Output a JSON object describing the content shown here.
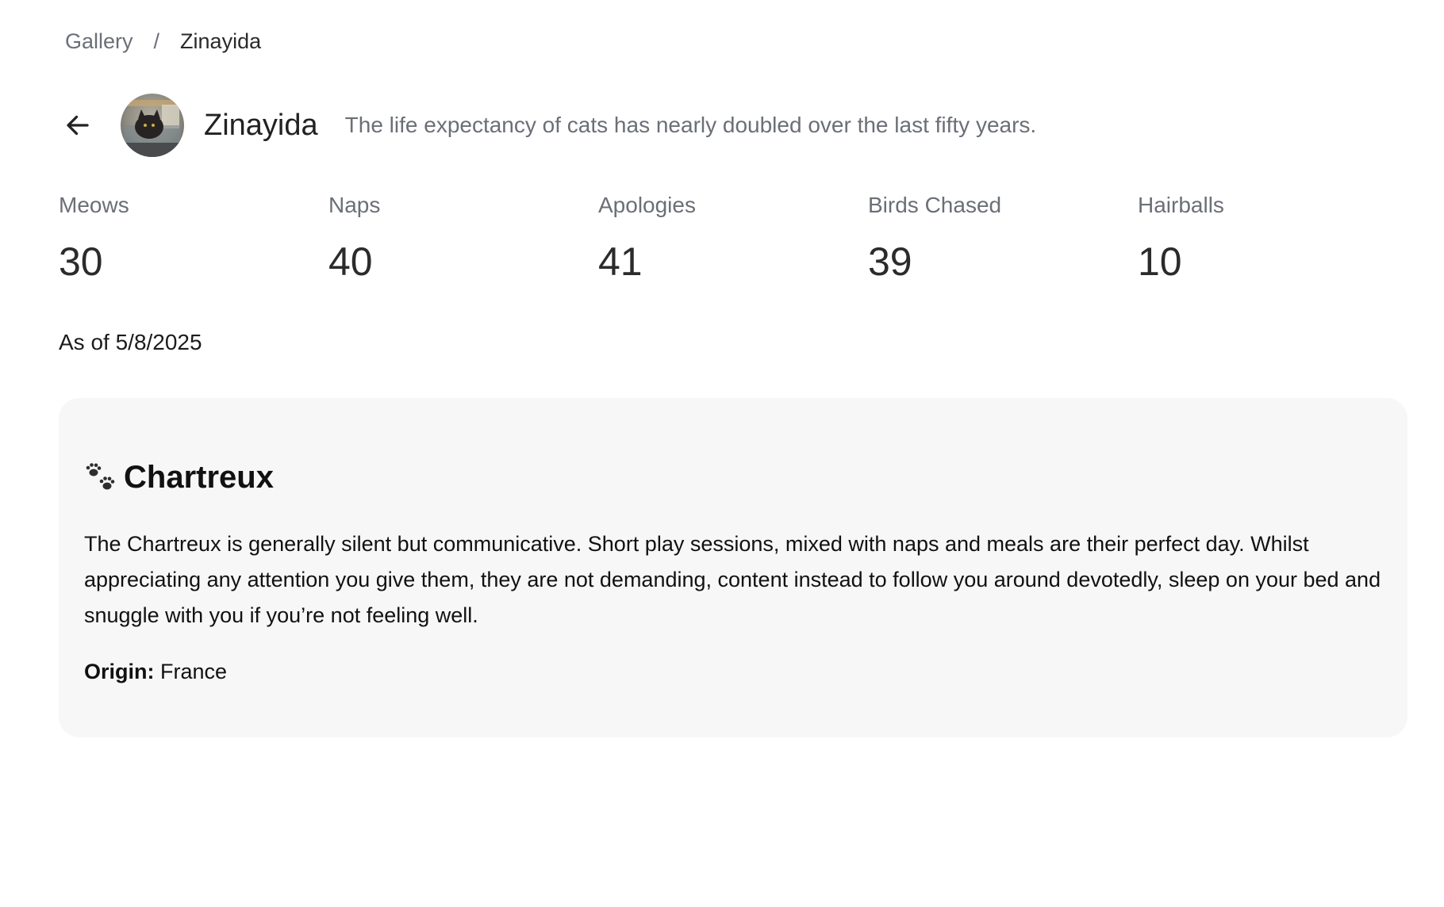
{
  "breadcrumb": {
    "parent": "Gallery",
    "separator": "/",
    "current": "Zinayida"
  },
  "header": {
    "back_icon": "arrow-left-icon",
    "avatar_icon": "cat-photo",
    "name": "Zinayida",
    "tagline": "The life expectancy of cats has nearly doubled over the last fifty years."
  },
  "stats": [
    {
      "label": "Meows",
      "value": "30"
    },
    {
      "label": "Naps",
      "value": "40"
    },
    {
      "label": "Apologies",
      "value": "41"
    },
    {
      "label": "Birds Chased",
      "value": "39"
    },
    {
      "label": "Hairballs",
      "value": "10"
    }
  ],
  "as_of": "As of 5/8/2025",
  "breed": {
    "icon": "paw-prints-icon",
    "name": "Chartreux",
    "description": "The Chartreux is generally silent but communicative. Short play sessions, mixed with naps and meals are their perfect day. Whilst appreciating any attention you give them, they are not demanding, content instead to follow you around devotedly, sleep on your bed and snuggle with you if you’re not feeling well.",
    "origin_label": "Origin:",
    "origin_value": "France"
  },
  "colors": {
    "muted_text": "#6b6f76",
    "card_background": "#f7f7f7",
    "body_text": "#1c1c1c"
  }
}
